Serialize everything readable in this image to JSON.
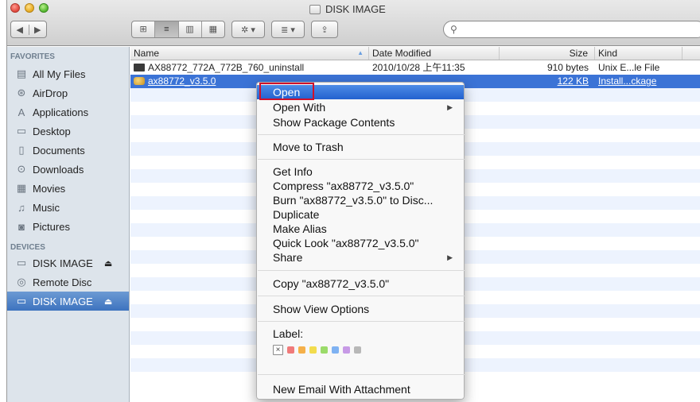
{
  "window": {
    "title": "DISK IMAGE"
  },
  "toolbar": {
    "back": "◀",
    "forward": "▶",
    "views": [
      "⊞",
      "≡",
      "▥",
      "▦"
    ],
    "action": "✲ ▾",
    "arrange": "≣ ▾",
    "share": "⇪",
    "search_placeholder": ""
  },
  "sidebar": {
    "favorites_header": "FAVORITES",
    "favorites": [
      {
        "label": "All My Files",
        "icon": "all-files-icon",
        "glyph": "▤"
      },
      {
        "label": "AirDrop",
        "icon": "airdrop-icon",
        "glyph": "⊛"
      },
      {
        "label": "Applications",
        "icon": "applications-icon",
        "glyph": "A"
      },
      {
        "label": "Desktop",
        "icon": "desktop-icon",
        "glyph": "▭"
      },
      {
        "label": "Documents",
        "icon": "documents-icon",
        "glyph": "▯"
      },
      {
        "label": "Downloads",
        "icon": "downloads-icon",
        "glyph": "⊙"
      },
      {
        "label": "Movies",
        "icon": "movies-icon",
        "glyph": "▦"
      },
      {
        "label": "Music",
        "icon": "music-icon",
        "glyph": "♫"
      },
      {
        "label": "Pictures",
        "icon": "pictures-icon",
        "glyph": "◙"
      }
    ],
    "devices_header": "DEVICES",
    "devices": [
      {
        "label": "DISK IMAGE",
        "icon": "disk-icon",
        "glyph": "▭",
        "eject": "⏏"
      },
      {
        "label": "Remote Disc",
        "icon": "remote-disc-icon",
        "glyph": "◎",
        "eject": ""
      },
      {
        "label": "DISK IMAGE",
        "icon": "disk-icon",
        "glyph": "▭",
        "eject": "⏏"
      }
    ]
  },
  "list": {
    "columns": {
      "name": "Name",
      "date": "Date Modified",
      "size": "Size",
      "kind": "Kind"
    },
    "files": [
      {
        "name": "AX88772_772A_772B_760_uninstall",
        "date": "2010/10/28 上午11:35",
        "size": "910 bytes",
        "kind": "Unix E...le File",
        "icon": "executable-icon"
      },
      {
        "name": "ax88772_v3.5.0",
        "date": "",
        "size": "122 KB",
        "kind": "Install...ckage",
        "icon": "package-icon"
      }
    ]
  },
  "context_menu": {
    "items": {
      "open": "Open",
      "open_with": "Open With",
      "show_package_contents": "Show Package Contents",
      "move_to_trash": "Move to Trash",
      "get_info": "Get Info",
      "compress": "Compress \"ax88772_v3.5.0\"",
      "burn": "Burn \"ax88772_v3.5.0\" to Disc...",
      "duplicate": "Duplicate",
      "make_alias": "Make Alias",
      "quick_look": "Quick Look \"ax88772_v3.5.0\"",
      "share": "Share",
      "copy": "Copy \"ax88772_v3.5.0\"",
      "show_view_options": "Show View Options",
      "label": "Label:",
      "new_email": "New Email With Attachment"
    },
    "submenu_arrow": "▶",
    "label_none": "×",
    "label_colors": [
      "#f07a7a",
      "#f5b04a",
      "#f2dc4e",
      "#9bdb6a",
      "#7fb2f2",
      "#c79ae6",
      "#b8b8b8"
    ]
  }
}
